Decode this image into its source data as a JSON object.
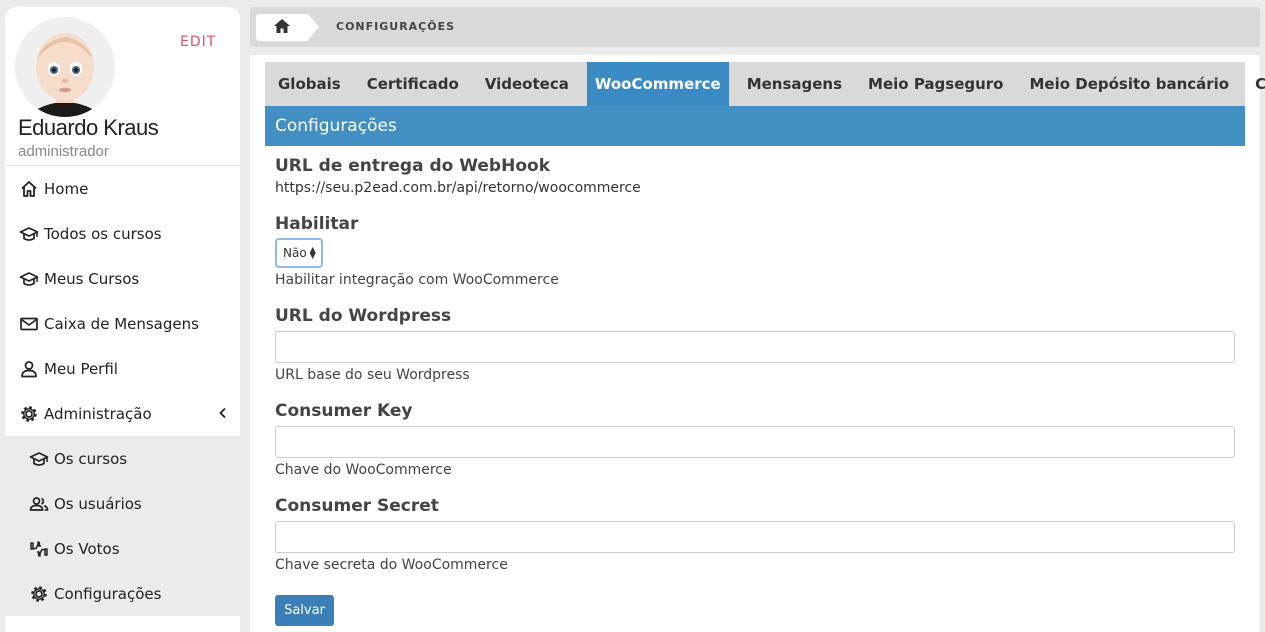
{
  "profile": {
    "edit_label": "EDIT",
    "name": "Eduardo Kraus",
    "role": "administrador"
  },
  "sidebar": {
    "items": [
      {
        "label": "Home",
        "icon": "home-icon"
      },
      {
        "label": "Todos os cursos",
        "icon": "graduation-cap-icon"
      },
      {
        "label": "Meus Cursos",
        "icon": "graduation-cap-icon"
      },
      {
        "label": "Caixa de Mensagens",
        "icon": "mail-icon"
      },
      {
        "label": "Meu Perfil",
        "icon": "user-icon"
      },
      {
        "label": "Administração",
        "icon": "gear-icon"
      }
    ],
    "admin_items": [
      {
        "label": "Os cursos",
        "icon": "graduation-cap-icon"
      },
      {
        "label": "Os usuários",
        "icon": "users-icon"
      },
      {
        "label": "Os Votos",
        "icon": "thumbs-icon"
      },
      {
        "label": "Configurações",
        "icon": "gear-icon"
      }
    ]
  },
  "breadcrumb": {
    "current": "CONFIGURAÇÕES"
  },
  "tabs": [
    {
      "label": "Globais",
      "active": false
    },
    {
      "label": "Certificado",
      "active": false
    },
    {
      "label": "Videoteca",
      "active": false
    },
    {
      "label": "WooCommerce",
      "active": true
    },
    {
      "label": "Mensagens",
      "active": false
    },
    {
      "label": "Meio Pagseguro",
      "active": false
    },
    {
      "label": "Meio Depósito bancário",
      "active": false
    },
    {
      "label": "Cache",
      "active": false
    }
  ],
  "section": {
    "title": "Configurações"
  },
  "form": {
    "webhook_label": "URL de entrega do WebHook",
    "webhook_value": "https://seu.p2ead.com.br/api/retorno/woocommerce",
    "habilitar_label": "Habilitar",
    "habilitar_value": "Não",
    "habilitar_help": "Habilitar integração com WooCommerce",
    "wordpress_label": "URL do Wordpress",
    "wordpress_value": "",
    "wordpress_help": "URL base do seu Wordpress",
    "consumer_key_label": "Consumer Key",
    "consumer_key_value": "",
    "consumer_key_help": "Chave do WooCommerce",
    "consumer_secret_label": "Consumer Secret",
    "consumer_secret_value": "",
    "consumer_secret_help": "Chave secreta do WooCommerce",
    "save_label": "Salvar"
  },
  "colors": {
    "accent": "#428fc3",
    "active_tab": "#3a8ac4",
    "edit_link": "#e0506a",
    "save_button": "#3b7fb8"
  }
}
